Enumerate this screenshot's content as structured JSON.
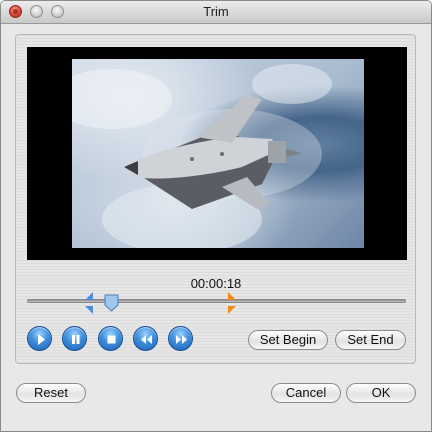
{
  "window": {
    "title": "Trim"
  },
  "player": {
    "timecode": "00:00:18"
  },
  "buttons": {
    "set_begin": "Set Begin",
    "set_end": "Set End",
    "reset": "Reset",
    "cancel": "Cancel",
    "ok": "OK"
  },
  "controls": [
    "play-icon",
    "pause-icon",
    "stop-icon",
    "rewind-icon",
    "fast-forward-icon"
  ],
  "colors": {
    "accent": "#2f7fd3",
    "begin_marker": "#3a7fd0",
    "end_marker": "#f08a1c"
  }
}
